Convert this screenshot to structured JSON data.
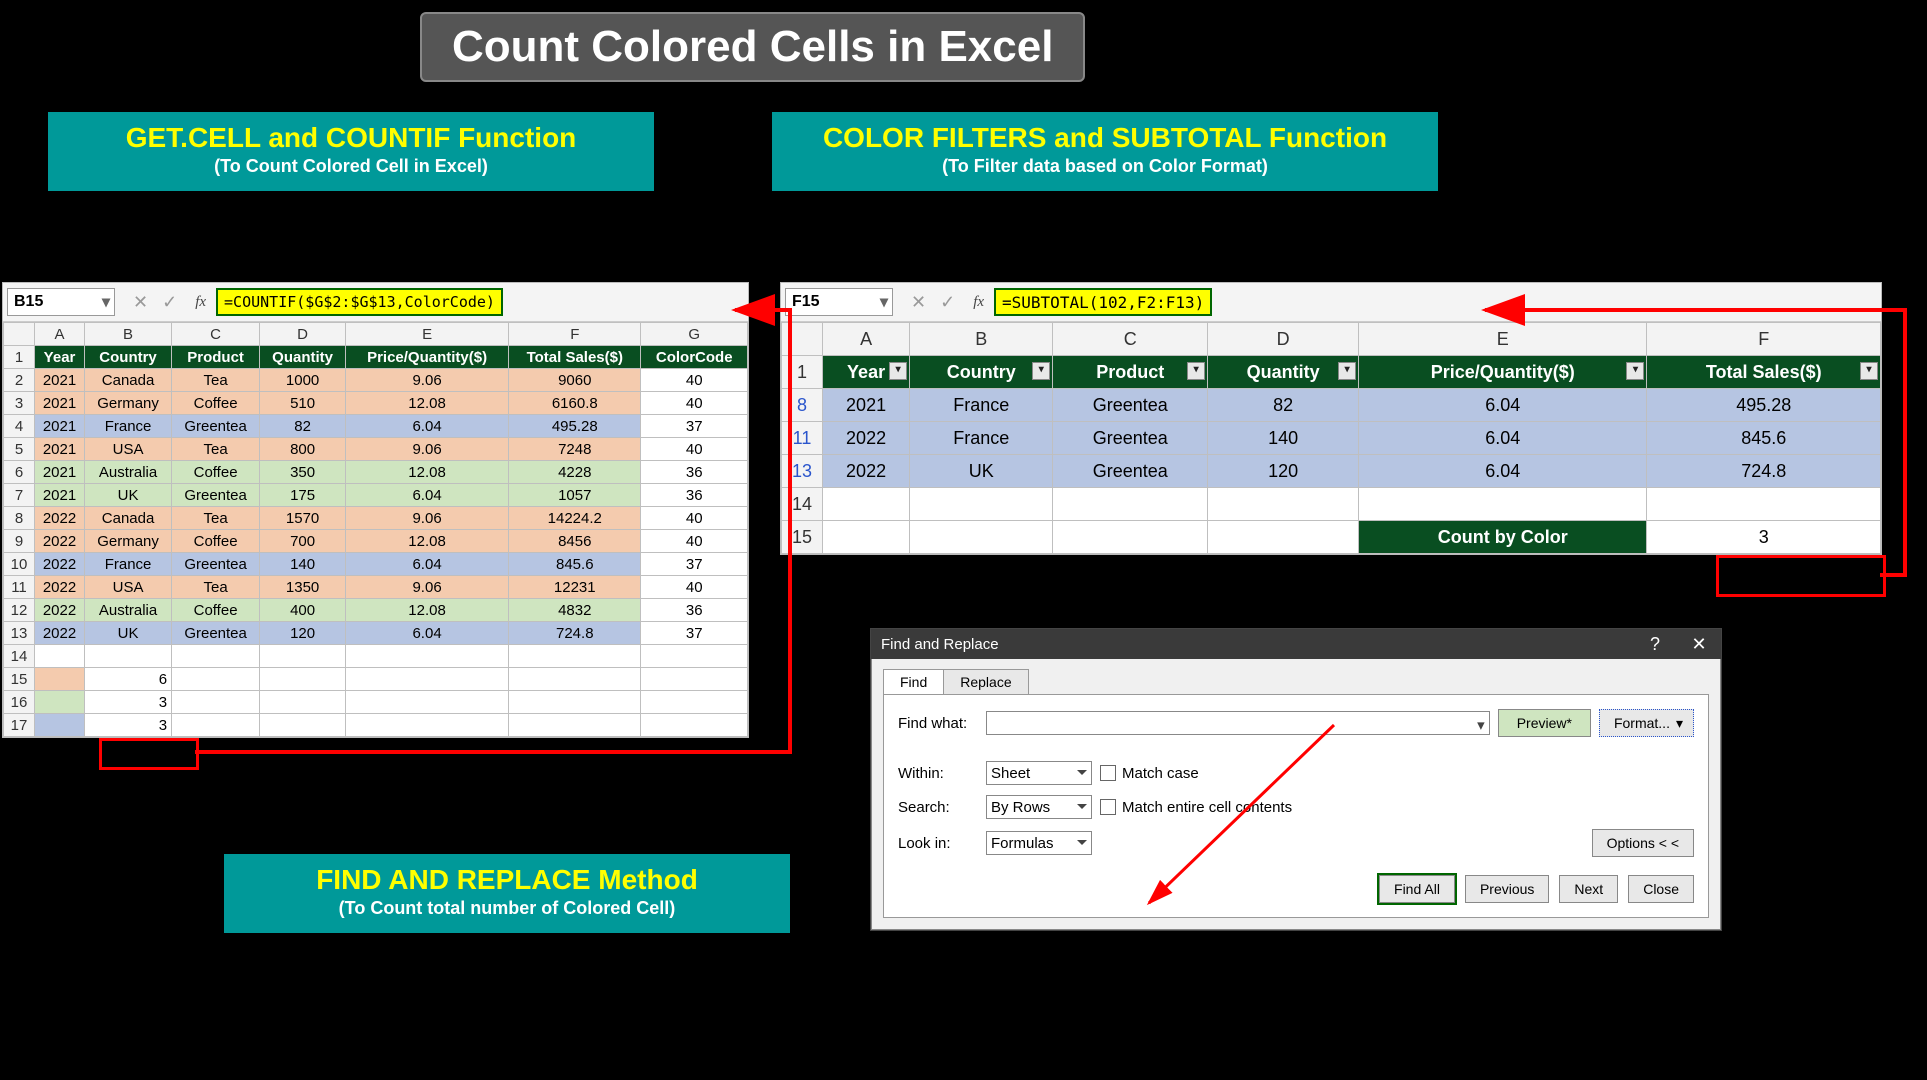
{
  "title": "Count Colored Cells in Excel",
  "cards": {
    "left": {
      "headline": "GET.CELL and COUNTIF Function",
      "sub": "(To Count Colored Cell in Excel)"
    },
    "right": {
      "headline": "COLOR FILTERS and SUBTOTAL Function",
      "sub": "(To Filter data based on Color Format)"
    },
    "find": {
      "headline": "FIND AND REPLACE Method",
      "sub": "(To Count total number of Colored Cell)"
    }
  },
  "left": {
    "namebox": "B15",
    "formula": "=COUNTIF($G$2:$G$13,ColorCode)",
    "cols": [
      "A",
      "B",
      "C",
      "D",
      "E",
      "F",
      "G"
    ],
    "headers": [
      "Year",
      "Country",
      "Product",
      "Quantity",
      "Price/Quantity($)",
      "Total Sales($)",
      "ColorCode"
    ],
    "rows": [
      {
        "n": 2,
        "c": "peach",
        "d": [
          "2021",
          "Canada",
          "Tea",
          "1000",
          "9.06",
          "9060",
          "40"
        ]
      },
      {
        "n": 3,
        "c": "peach",
        "d": [
          "2021",
          "Germany",
          "Coffee",
          "510",
          "12.08",
          "6160.8",
          "40"
        ]
      },
      {
        "n": 4,
        "c": "blue",
        "d": [
          "2021",
          "France",
          "Greentea",
          "82",
          "6.04",
          "495.28",
          "37"
        ]
      },
      {
        "n": 5,
        "c": "peach",
        "d": [
          "2021",
          "USA",
          "Tea",
          "800",
          "9.06",
          "7248",
          "40"
        ]
      },
      {
        "n": 6,
        "c": "green",
        "d": [
          "2021",
          "Australia",
          "Coffee",
          "350",
          "12.08",
          "4228",
          "36"
        ]
      },
      {
        "n": 7,
        "c": "green",
        "d": [
          "2021",
          "UK",
          "Greentea",
          "175",
          "6.04",
          "1057",
          "36"
        ]
      },
      {
        "n": 8,
        "c": "peach",
        "d": [
          "2022",
          "Canada",
          "Tea",
          "1570",
          "9.06",
          "14224.2",
          "40"
        ]
      },
      {
        "n": 9,
        "c": "peach",
        "d": [
          "2022",
          "Germany",
          "Coffee",
          "700",
          "12.08",
          "8456",
          "40"
        ]
      },
      {
        "n": 10,
        "c": "blue",
        "d": [
          "2022",
          "France",
          "Greentea",
          "140",
          "6.04",
          "845.6",
          "37"
        ]
      },
      {
        "n": 11,
        "c": "peach",
        "d": [
          "2022",
          "USA",
          "Tea",
          "1350",
          "9.06",
          "12231",
          "40"
        ]
      },
      {
        "n": 12,
        "c": "green",
        "d": [
          "2022",
          "Australia",
          "Coffee",
          "400",
          "12.08",
          "4832",
          "36"
        ]
      },
      {
        "n": 13,
        "c": "blue",
        "d": [
          "2022",
          "UK",
          "Greentea",
          "120",
          "6.04",
          "724.8",
          "37"
        ]
      }
    ],
    "result15": {
      "a_color": "peach",
      "b": "6"
    },
    "result16": {
      "a_color": "green",
      "b": "3"
    },
    "result17": {
      "a_color": "blue",
      "b": "3"
    }
  },
  "right": {
    "namebox": "F15",
    "formula": "=SUBTOTAL(102,F2:F13)",
    "cols": [
      "A",
      "B",
      "C",
      "D",
      "E",
      "F"
    ],
    "headers": [
      "Year",
      "Country",
      "Product",
      "Quantity",
      "Price/Quantity($)",
      "Total Sales($)"
    ],
    "rows": [
      {
        "n": 8,
        "d": [
          "2021",
          "France",
          "Greentea",
          "82",
          "6.04",
          "495.28"
        ]
      },
      {
        "n": 11,
        "d": [
          "2022",
          "France",
          "Greentea",
          "140",
          "6.04",
          "845.6"
        ]
      },
      {
        "n": 13,
        "d": [
          "2022",
          "UK",
          "Greentea",
          "120",
          "6.04",
          "724.8"
        ]
      }
    ],
    "count_label": "Count by Color",
    "count_value": "3"
  },
  "dlg": {
    "title": "Find and Replace",
    "tab_find": "Find",
    "tab_replace": "Replace",
    "find_what": "Find what:",
    "preview": "Preview*",
    "format": "Format...",
    "within": "Within:",
    "within_v": "Sheet",
    "search": "Search:",
    "search_v": "By Rows",
    "lookin": "Look in:",
    "lookin_v": "Formulas",
    "match_case": "Match case",
    "match_entire": "Match entire cell contents",
    "options": "Options < <",
    "find_all": "Find All",
    "previous": "Previous",
    "next": "Next",
    "close": "Close"
  }
}
